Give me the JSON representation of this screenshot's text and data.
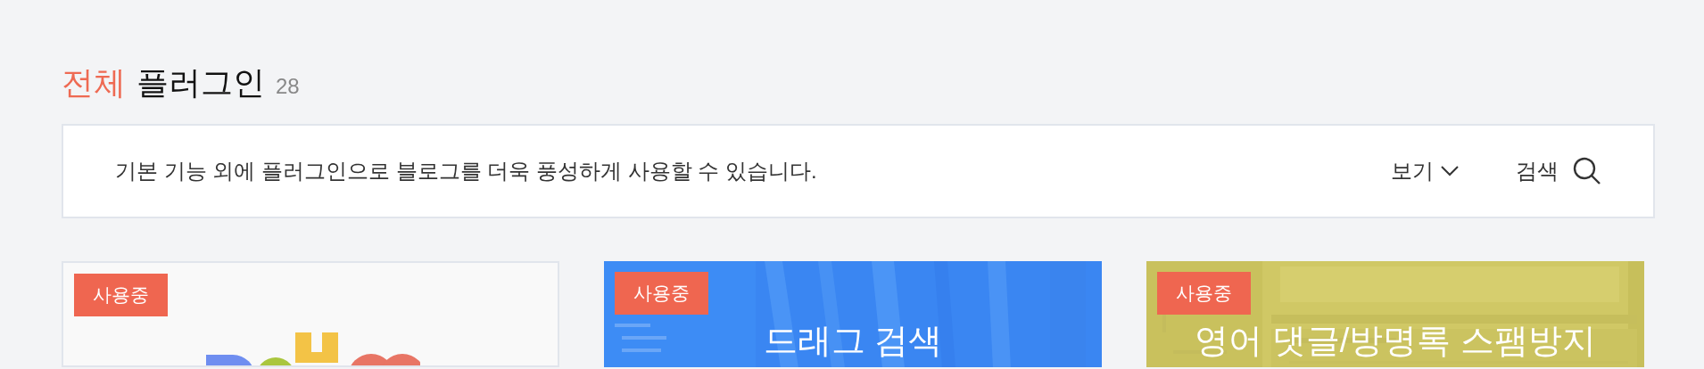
{
  "heading": {
    "accent": "전체",
    "title": "플러그인",
    "count": "28"
  },
  "info_bar": {
    "description": "기본 기능 외에 플러그인으로 블로그를 더욱 풍성하게 사용할 수 있습니다.",
    "view_label": "보기",
    "search_label": "검색"
  },
  "cards": [
    {
      "kind": "logo",
      "badge": "사용중"
    },
    {
      "kind": "blue",
      "badge": "사용중",
      "title": "드래그 검색"
    },
    {
      "kind": "olive",
      "badge": "사용중",
      "title": "영어 댓글/방명록 스팸방지"
    }
  ]
}
